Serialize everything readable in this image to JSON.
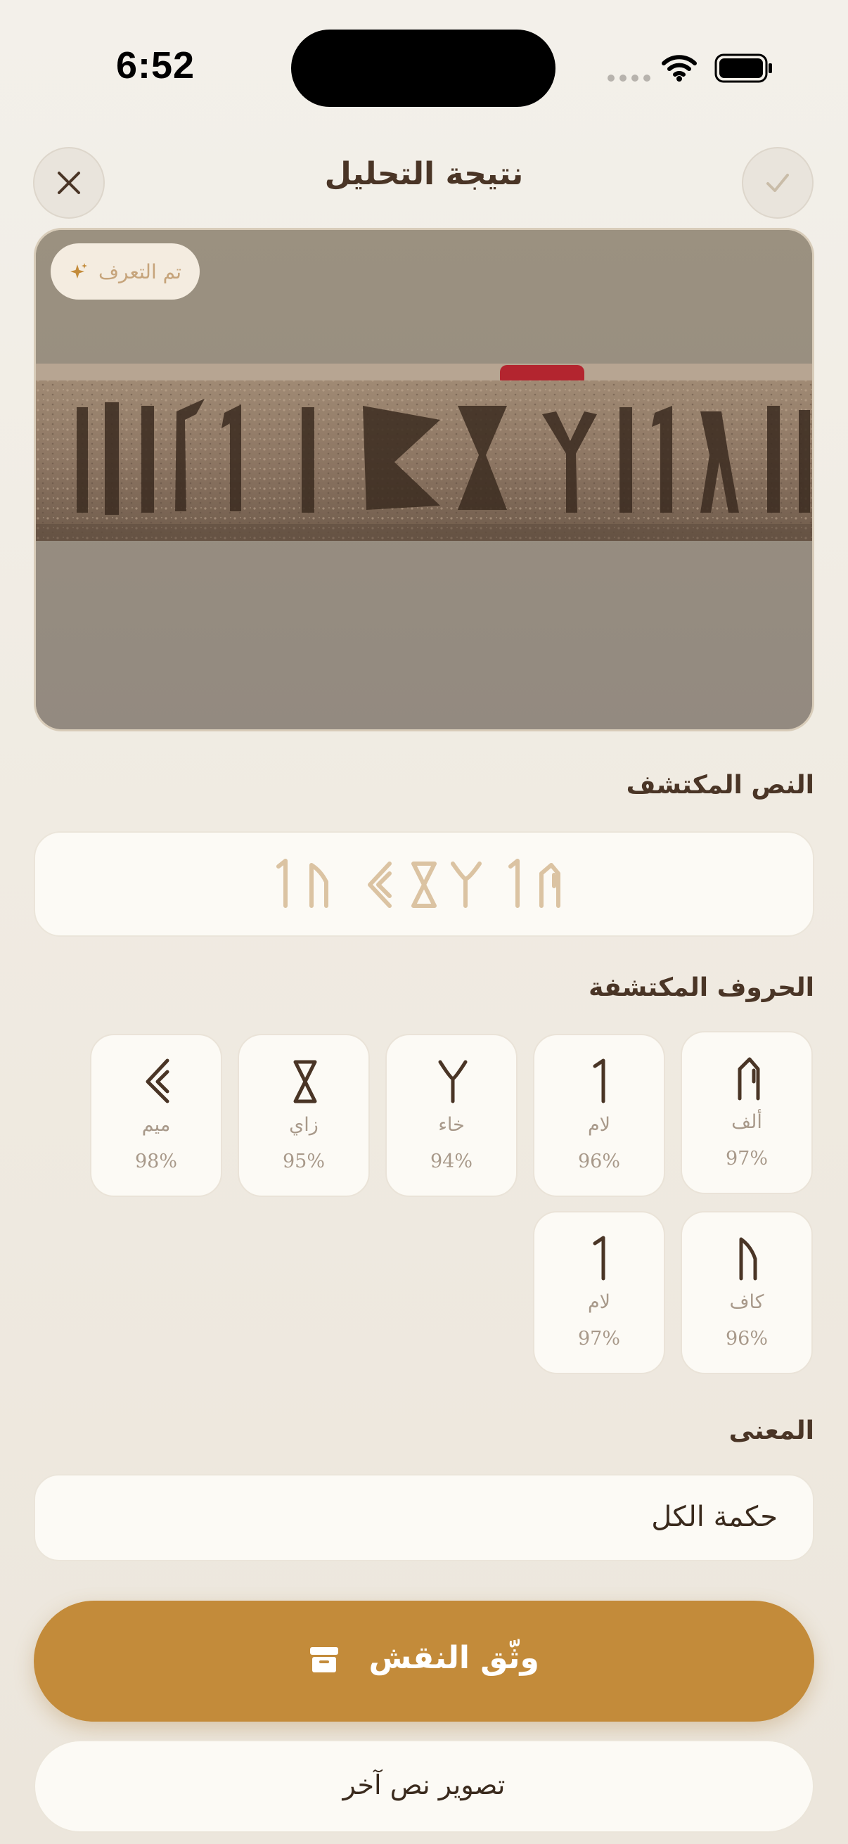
{
  "status_bar": {
    "time": "6:52"
  },
  "header": {
    "title": "نتيجة التحليل",
    "close_icon": "close-icon",
    "confirm_icon": "checkmark-icon"
  },
  "photo": {
    "badge_label": "تم التعرف",
    "badge_icon": "sparkles-icon"
  },
  "detected_text": {
    "section_label": "النص المكتشف",
    "value": "𐩡𐩫 𐩣𐩹𐩭 𐩡𐩱"
  },
  "detected_letters": {
    "section_label": "الحروف المكتشفة",
    "items": [
      {
        "glyph": "𐩱",
        "name": "ألف",
        "confidence": "97%"
      },
      {
        "glyph": "𐩡",
        "name": "لام",
        "confidence": "96%"
      },
      {
        "glyph": "𐩭",
        "name": "خاء",
        "confidence": "94%"
      },
      {
        "glyph": "𐩹",
        "name": "زاي",
        "confidence": "95%"
      },
      {
        "glyph": "𐩣",
        "name": "ميم",
        "confidence": "98%"
      },
      {
        "glyph": "𐩫",
        "name": "كاف",
        "confidence": "96%"
      },
      {
        "glyph": "𐩡",
        "name": "لام",
        "confidence": "97%"
      }
    ]
  },
  "meaning": {
    "section_label": "المعنى",
    "value": "حكمة الكل"
  },
  "actions": {
    "document_label": "وثّق النقش",
    "document_icon": "archive-box-icon",
    "retake_label": "تصوير نص آخر"
  },
  "colors": {
    "accent": "#c38b3a",
    "text_primary": "#4a3526",
    "background": "#f2eee7",
    "card": "#fcfaf5"
  }
}
